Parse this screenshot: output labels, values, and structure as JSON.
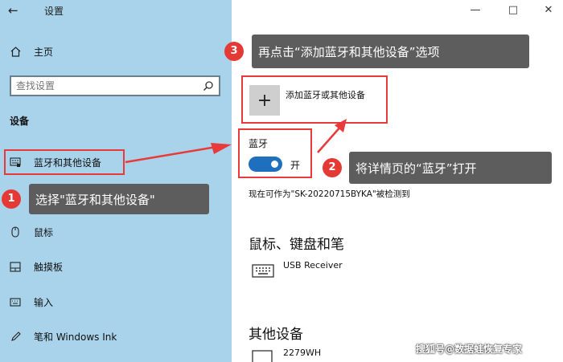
{
  "window": {
    "title": "设置"
  },
  "nav": {
    "home": "主页",
    "search_placeholder": "查找设置",
    "section": "设备",
    "items": [
      {
        "label": "蓝牙和其他设备"
      },
      {
        "label": "鼠标"
      },
      {
        "label": "触摸板"
      },
      {
        "label": "输入"
      },
      {
        "label": "笔和 Windows Ink"
      }
    ]
  },
  "main": {
    "add_device_label": "添加蓝牙或其他设备",
    "bluetooth_label": "蓝牙",
    "bluetooth_state": "开",
    "discover_text": "现在可作为\"SK-20220715BYKA\"被检测到",
    "mouse_section": "鼠标、键盘和笔",
    "usb_receiver": "USB Receiver",
    "other_section": "其他设备",
    "other_device": "2279WH"
  },
  "annotations": {
    "step1": {
      "number": "1",
      "text": "选择\"蓝牙和其他设备\""
    },
    "step2": {
      "number": "2",
      "text": "将详情页的“蓝牙”打开"
    },
    "step3": {
      "number": "3",
      "text": "再点击“添加蓝牙和其他设备”选项"
    }
  },
  "watermark": "搜狐号@数据蛙恢复专家",
  "colors": {
    "sidebar_bg": "#a9d3ea",
    "accent": "#1f6fbf",
    "annotation_red": "#e83a3a",
    "callout_bg": "#5d5d5d"
  }
}
